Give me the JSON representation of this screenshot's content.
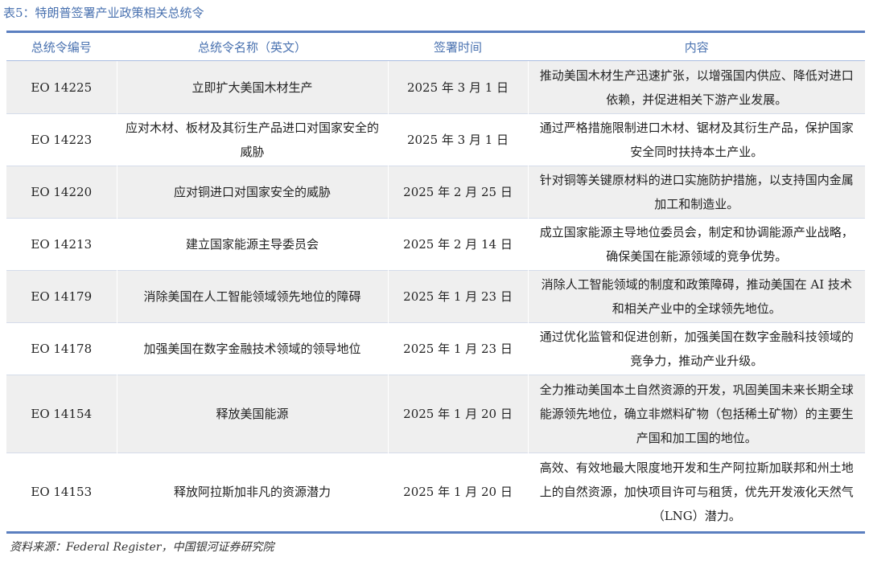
{
  "title": "表5：特朗普签署产业政策相关总统令",
  "headers": [
    "总统令编号",
    "总统令名称（英文）",
    "签署时间",
    "内容"
  ],
  "rows": [
    {
      "id": "EO 14225",
      "name": "立即扩大美国木材生产",
      "date": "2025 年 3 月 1 日",
      "content": "推动美国木材生产迅速扩张，以增强国内供应、降低对进口依赖，并促进相关下游产业发展。"
    },
    {
      "id": "EO 14223",
      "name": "应对木材、板材及其衍生产品进口对国家安全的威胁",
      "date": "2025 年 3 月 1 日",
      "content": "通过严格措施限制进口木材、锯材及其衍生产品，保护国家安全同时扶持本土产业。"
    },
    {
      "id": "EO 14220",
      "name": "应对铜进口对国家安全的威胁",
      "date": "2025 年 2 月 25 日",
      "content": "针对铜等关键原材料的进口实施防护措施，以支持国内金属加工和制造业。"
    },
    {
      "id": "EO 14213",
      "name": "建立国家能源主导委员会",
      "date": "2025 年 2 月 14 日",
      "content": "成立国家能源主导地位委员会，制定和协调能源产业战略，确保美国在能源领域的竞争优势。"
    },
    {
      "id": "EO 14179",
      "name": "消除美国在人工智能领域领先地位的障碍",
      "date": "2025 年 1 月 23 日",
      "content": "消除人工智能领域的制度和政策障碍，推动美国在 AI 技术和相关产业中的全球领先地位。"
    },
    {
      "id": "EO 14178",
      "name": "加强美国在数字金融技术领域的领导地位",
      "date": "2025 年 1 月 23 日",
      "content": "通过优化监管和促进创新，加强美国在数字金融科技领域的竞争力，推动产业升级。"
    },
    {
      "id": "EO 14154",
      "name": "释放美国能源",
      "date": "2025 年 1 月 20 日",
      "content": "全力推动美国本土自然资源的开发，巩固美国未来长期全球能源领先地位，确立非燃料矿物（包括稀土矿物）的主要生产国和加工国的地位。"
    },
    {
      "id": "EO 14153",
      "name": "释放阿拉斯加非凡的资源潜力",
      "date": "2025 年 1 月 20 日",
      "content": "高效、有效地最大限度地开发和生产阿拉斯加联邦和州土地上的自然资源，加快项目许可与租赁，优先开发液化天然气（LNG）潜力。"
    }
  ],
  "source": "资料来源：Federal Register，中国银河证券研究院"
}
